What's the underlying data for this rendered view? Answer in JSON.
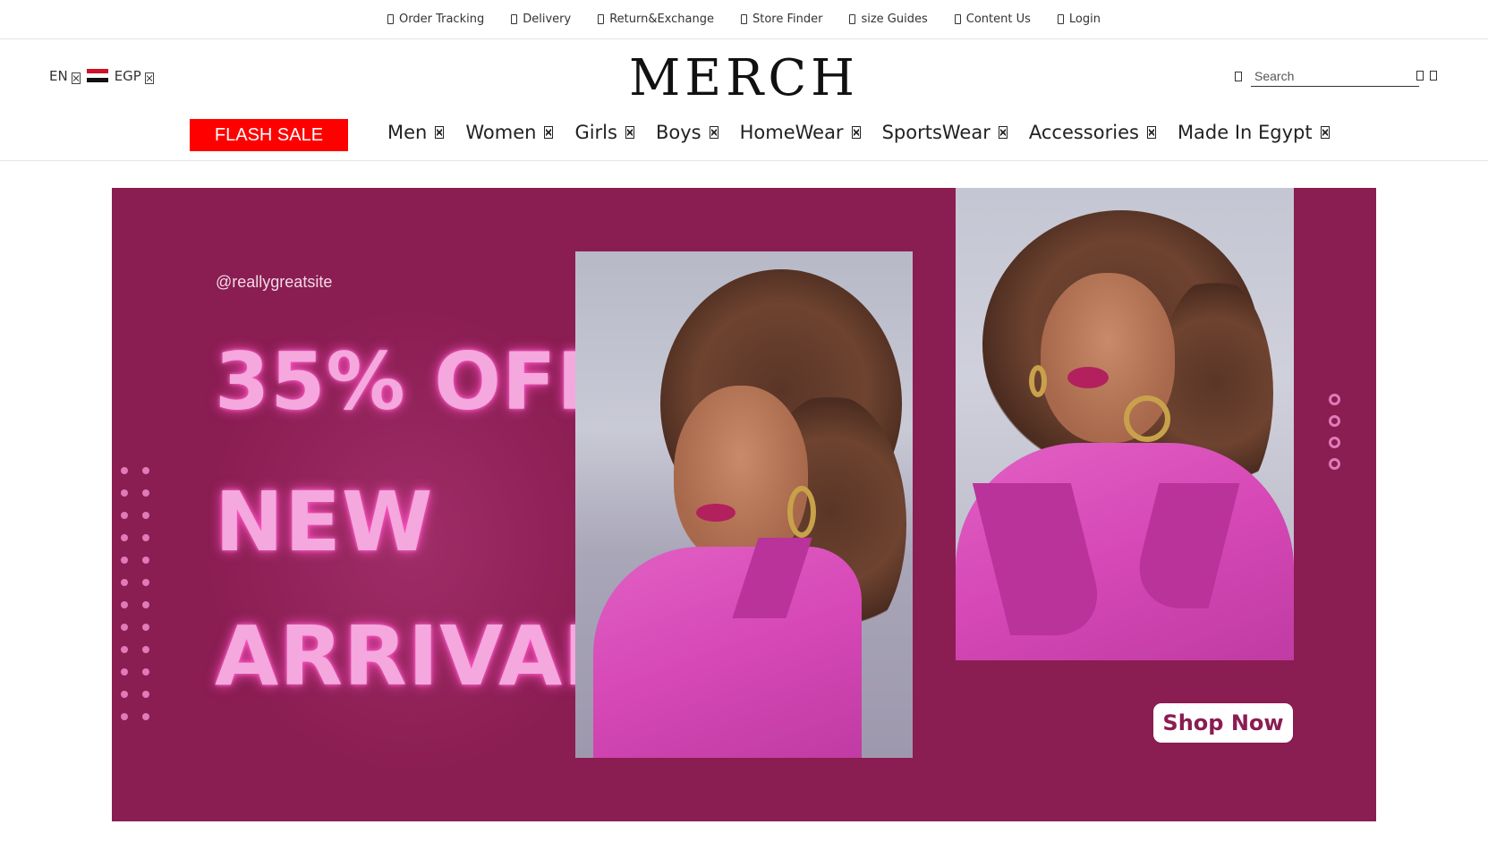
{
  "topbar": {
    "items": [
      {
        "label": "Order Tracking",
        "icon": "box-glyph-icon"
      },
      {
        "label": "Delivery",
        "icon": "box-glyph-icon"
      },
      {
        "label": "Return&Exchange",
        "icon": "box-glyph-icon"
      },
      {
        "label": "Store Finder",
        "icon": "box-glyph-icon"
      },
      {
        "label": "size Guides",
        "icon": "box-glyph-icon"
      },
      {
        "label": "Content Us",
        "icon": "box-glyph-icon"
      },
      {
        "label": "Login",
        "icon": "box-glyph-icon"
      }
    ]
  },
  "header": {
    "language": "EN",
    "currency": "EGP",
    "logo": "MERCH",
    "search_placeholder": "Search"
  },
  "nav": {
    "flash_sale": "FLASH SALE",
    "items": [
      {
        "label": "Men"
      },
      {
        "label": "Women"
      },
      {
        "label": "Girls"
      },
      {
        "label": "Boys"
      },
      {
        "label": "HomeWear"
      },
      {
        "label": "SportsWear"
      },
      {
        "label": "Accessories"
      },
      {
        "label": "Made In Egypt"
      }
    ]
  },
  "hero": {
    "handle": "@reallygreatsite",
    "line1": "35% OFF",
    "line2": "NEW",
    "line3": "ARRIVAL",
    "cta": "Shop Now",
    "colors": {
      "background": "#8a1d52",
      "headline": "#f5a8de",
      "accent": "#e07ab9"
    }
  },
  "colors": {
    "flash_sale": "#ff0000"
  }
}
